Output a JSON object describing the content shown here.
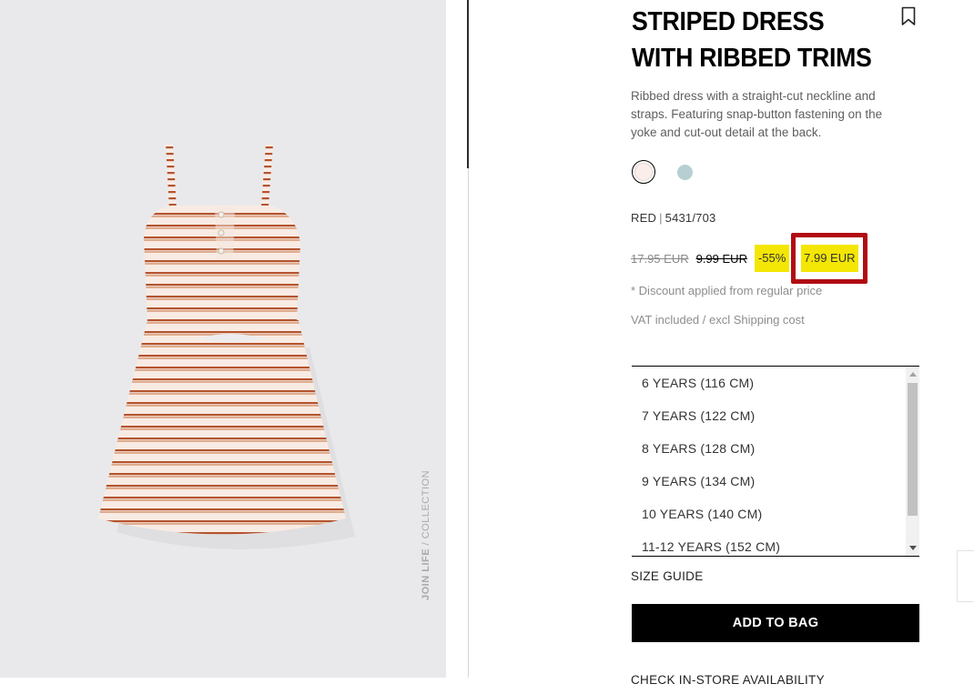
{
  "product": {
    "title_line1": "STRIPED DRESS",
    "title_line2": "WITH RIBBED TRIMS",
    "description": "Ribbed dress with a straight-cut neckline and straps. Featuring snap-button fastening on the yoke and cut-out detail at the back.",
    "color_name": "RED",
    "reference": "5431/703",
    "colors": [
      {
        "name": "cream",
        "hex": "#fbeeea",
        "selected": true
      },
      {
        "name": "light blue",
        "hex": "#b7cfd3",
        "selected": false
      }
    ]
  },
  "image": {
    "tag_bold": "JOIN LIFE",
    "tag_rest": " / COLLECTION"
  },
  "pricing": {
    "original": "17.95 EUR",
    "previous": "9.99 EUR",
    "discount": "-55%",
    "final": "7.99 EUR",
    "discount_note": "* Discount applied from regular price",
    "vat_note": "VAT included / excl Shipping cost"
  },
  "sizes": [
    "6 YEARS (116 CM)",
    "7 YEARS (122 CM)",
    "8 YEARS (128 CM)",
    "9 YEARS (134 CM)",
    "10 YEARS (140 CM)",
    "11-12 YEARS (152 CM)"
  ],
  "actions": {
    "size_guide": "SIZE GUIDE",
    "add_to_bag": "ADD TO BAG",
    "store_availability": "CHECK IN-STORE AVAILABILITY"
  },
  "colors": {
    "highlight": "#f4e604",
    "annotation": "#b10c12",
    "button": "#000000"
  }
}
